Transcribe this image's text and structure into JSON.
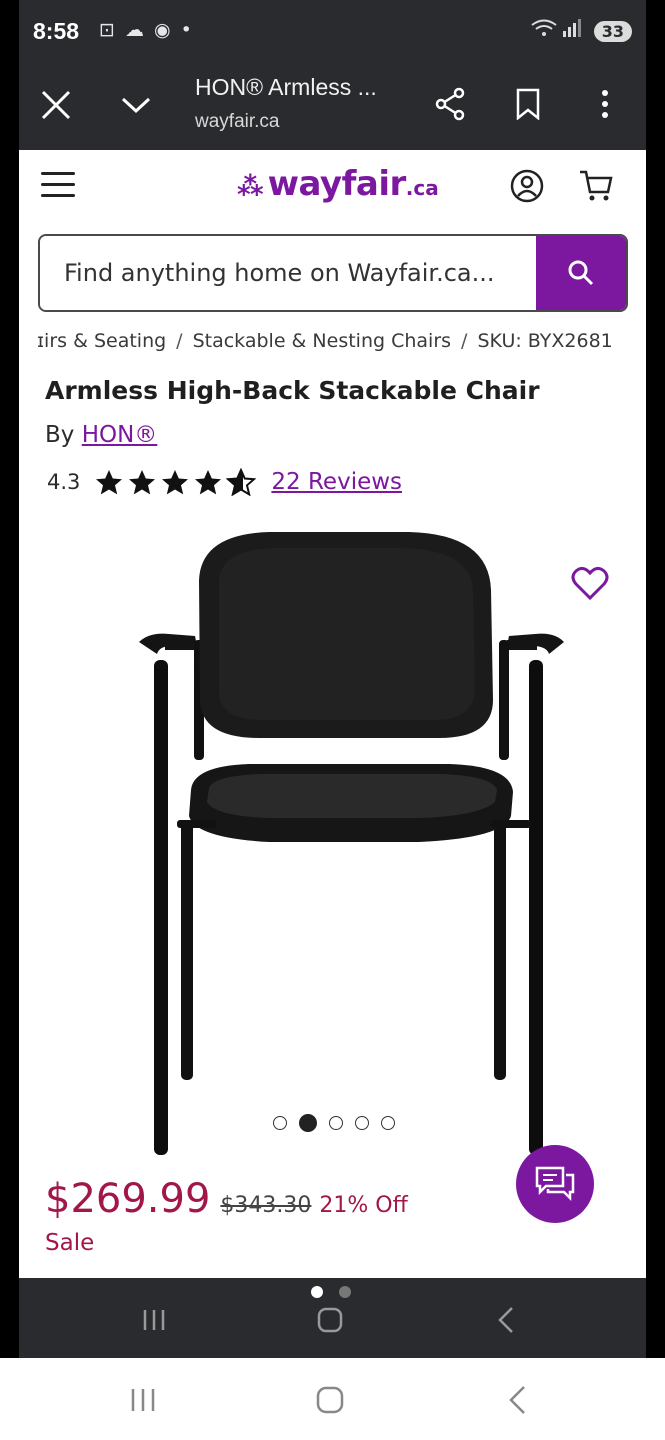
{
  "status_bar": {
    "time": "8:58",
    "left_icons": "⊡ ☁ ◉ •",
    "battery": "33"
  },
  "browser": {
    "tab_title": "HON® Armless ...",
    "url": "wayfair.ca"
  },
  "site": {
    "logo_word": "wayfair",
    "logo_tld": ".ca",
    "search_placeholder": "Find anything home on Wayfair.ca..."
  },
  "breadcrumb": {
    "items": [
      "ɪirs & Seating",
      "Stackable & Nesting Chairs",
      "SKU: BYX2681"
    ],
    "separator": "/"
  },
  "product": {
    "title": "Armless High-Back Stackable Chair",
    "by_prefix": "By",
    "brand": "HON®",
    "rating": "4.3",
    "rating_value": 4.3,
    "rating_max": 5,
    "reviews": "22 Reviews",
    "image_count": 5,
    "active_image": 2
  },
  "price": {
    "sale": "$269.99",
    "original": "$343.30",
    "discount": "21% Off",
    "label": "Sale"
  },
  "colors": {
    "brand_purple": "#7b189f",
    "sale_red": "#a1174a",
    "chrome_dark": "#2a2b2e"
  }
}
